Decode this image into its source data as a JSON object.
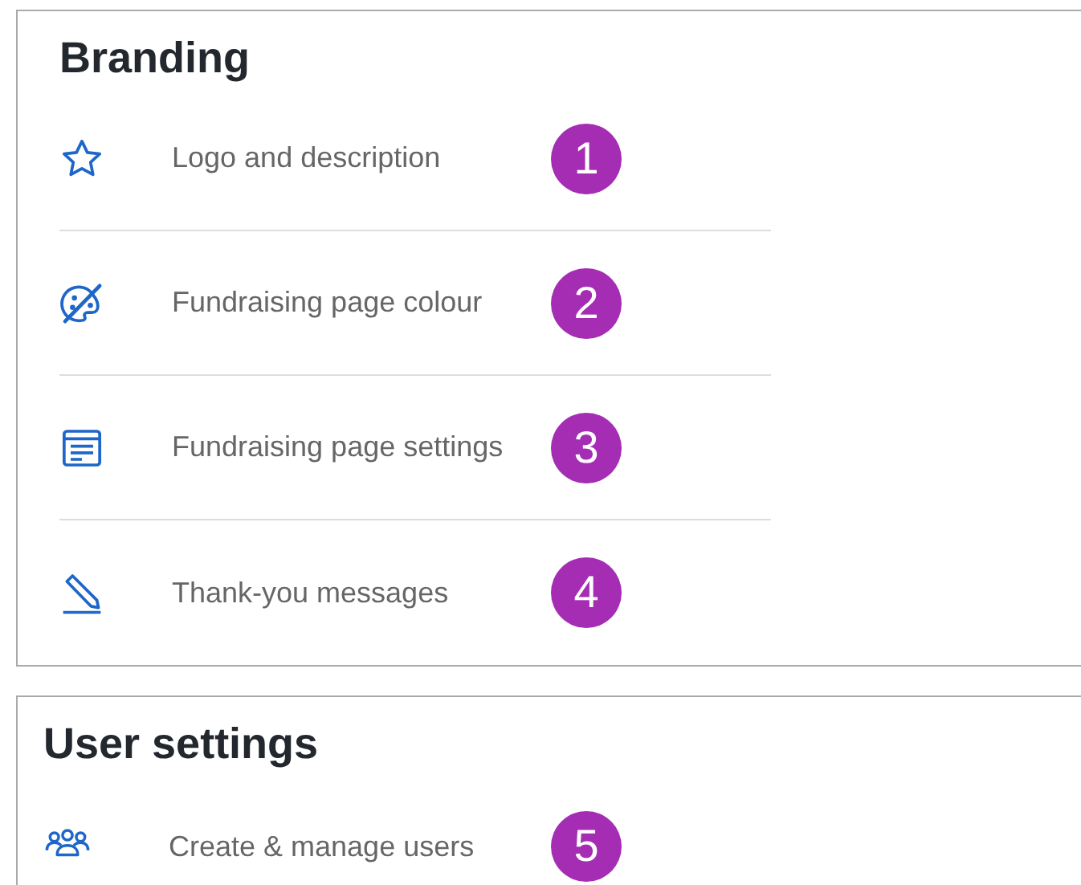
{
  "sections": [
    {
      "title": "Branding",
      "items": [
        {
          "kind": "star",
          "label": "Logo and description",
          "badge": "1"
        },
        {
          "kind": "palette",
          "label": "Fundraising page colour",
          "badge": "2"
        },
        {
          "kind": "page",
          "label": "Fundraising page settings",
          "badge": "3"
        },
        {
          "kind": "pencil",
          "label": "Thank-you messages",
          "badge": "4"
        }
      ]
    },
    {
      "title": "User settings",
      "items": [
        {
          "kind": "users",
          "label": "Create & manage users",
          "badge": "5"
        }
      ]
    }
  ]
}
